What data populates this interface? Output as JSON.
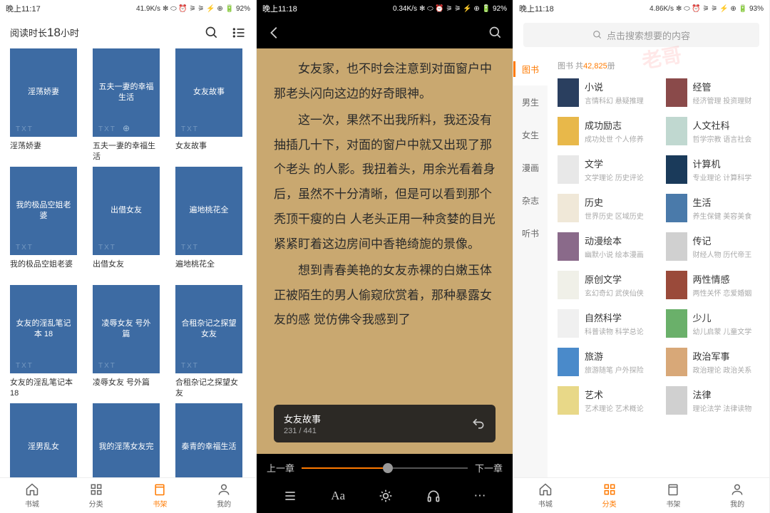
{
  "screen1": {
    "status": {
      "time": "晚上11:17",
      "speed": "41.9K/s",
      "battery": "92%"
    },
    "header": {
      "title_prefix": "阅读时长",
      "title_num": "18",
      "title_suffix": "小时"
    },
    "books": [
      {
        "cover": "淫荡娇妻",
        "title": "淫荡娇妻"
      },
      {
        "cover": "五夫一妻的幸福生活",
        "title": "五夫一妻的幸福生活",
        "upload": true
      },
      {
        "cover": "女友故事",
        "title": "女友故事"
      },
      {
        "cover": "我的极品空姐老婆",
        "title": "我的极品空姐老婆"
      },
      {
        "cover": "出借女友",
        "title": "出借女友"
      },
      {
        "cover": "遍地桃花全",
        "title": "遍地桃花全"
      },
      {
        "cover": "女友的淫乱笔记本 18",
        "title": "女友的淫乱笔记本 18"
      },
      {
        "cover": "凌辱女友 号外篇",
        "title": "凌辱女友 号外篇"
      },
      {
        "cover": "合租杂记之探望女友",
        "title": "合租杂记之探望女友"
      },
      {
        "cover": "淫男乱女",
        "title": ""
      },
      {
        "cover": "我的淫荡女友完",
        "title": ""
      },
      {
        "cover": "秦青的幸福生活",
        "title": ""
      }
    ],
    "txt_label": "TXT",
    "nav": [
      {
        "label": "书城",
        "icon": "home"
      },
      {
        "label": "分类",
        "icon": "grid"
      },
      {
        "label": "书架",
        "icon": "book",
        "active": true
      },
      {
        "label": "我的",
        "icon": "user"
      }
    ]
  },
  "screen2": {
    "status": {
      "time": "晚上11:18",
      "speed": "0.34K/s",
      "battery": "92%"
    },
    "paragraphs": [
      "女友家，也不时会注意到对面窗户中那老头闪向这边的好奇眼神。",
      "这一次，果然不出我所料，我还没有抽插几十下，对面的窗户中就又出现了那个老头 的人影。我扭着头，用余光看着身后，虽然不十分清晰，但是可以看到那个秃顶干瘦的白 人老头正用一种贪婪的目光紧紧盯着这边房间中香艳绮旎的景像。",
      "想到青春美艳的女友赤裸的白嫩玉体正被陌生的男人偷窥欣赏着，那种暴露女友的感 觉仿佛令我感到了"
    ],
    "toast": {
      "title": "女友故事",
      "progress": "231 / 441"
    },
    "prev": "上一章",
    "next": "下一章"
  },
  "screen3": {
    "status": {
      "time": "晚上11:18",
      "speed": "4.86K/s",
      "battery": "93%"
    },
    "search_placeholder": "点击搜索想要的内容",
    "count_prefix": "图书 共",
    "count_num": "42,825",
    "count_suffix": "册",
    "side": [
      {
        "label": "图书",
        "active": true
      },
      {
        "label": "男生"
      },
      {
        "label": "女生"
      },
      {
        "label": "漫画"
      },
      {
        "label": "杂志"
      },
      {
        "label": "听书"
      }
    ],
    "cats": [
      {
        "title": "小说",
        "sub": "言情科幻 悬疑推理",
        "bg": "#2a3f5f"
      },
      {
        "title": "经管",
        "sub": "经济管理 投资理财",
        "bg": "#8a4a4a"
      },
      {
        "title": "成功励志",
        "sub": "成功处世 个人修养",
        "bg": "#e8b84a"
      },
      {
        "title": "人文社科",
        "sub": "哲学宗教 语言社会",
        "bg": "#c0d8d0"
      },
      {
        "title": "文学",
        "sub": "文学理论 历史评论",
        "bg": "#e8e8e8"
      },
      {
        "title": "计算机",
        "sub": "专业理论 计算科学",
        "bg": "#1a3a5a"
      },
      {
        "title": "历史",
        "sub": "世界历史 区域历史",
        "bg": "#f0e8d8"
      },
      {
        "title": "生活",
        "sub": "养生保健 美容美食",
        "bg": "#4a7aaa"
      },
      {
        "title": "动漫绘本",
        "sub": "幽默小说 绘本漫画",
        "bg": "#8a6a8a"
      },
      {
        "title": "传记",
        "sub": "财经人物 历代帝王",
        "bg": "#d0d0d0"
      },
      {
        "title": "原创文学",
        "sub": "玄幻奇幻 武侠仙侠",
        "bg": "#f0f0e8"
      },
      {
        "title": "两性情感",
        "sub": "两性关怀 恋爱婚姻",
        "bg": "#9a4a3a"
      },
      {
        "title": "自然科学",
        "sub": "科普读物 科学总论",
        "bg": "#f0f0f0"
      },
      {
        "title": "少儿",
        "sub": "幼儿启蒙 儿童文学",
        "bg": "#6ab06a"
      },
      {
        "title": "旅游",
        "sub": "旅游随笔 户外探险",
        "bg": "#4a8aca"
      },
      {
        "title": "政治军事",
        "sub": "政治理论 政治关系",
        "bg": "#d8a878"
      },
      {
        "title": "艺术",
        "sub": "艺术理论 艺术概论",
        "bg": "#e8d888"
      },
      {
        "title": "法律",
        "sub": "理论法学 法律读物",
        "bg": "#d0d0d0"
      }
    ],
    "nav": [
      {
        "label": "书城",
        "icon": "home"
      },
      {
        "label": "分类",
        "icon": "grid",
        "active": true
      },
      {
        "label": "书架",
        "icon": "book"
      },
      {
        "label": "我的",
        "icon": "user"
      }
    ]
  }
}
